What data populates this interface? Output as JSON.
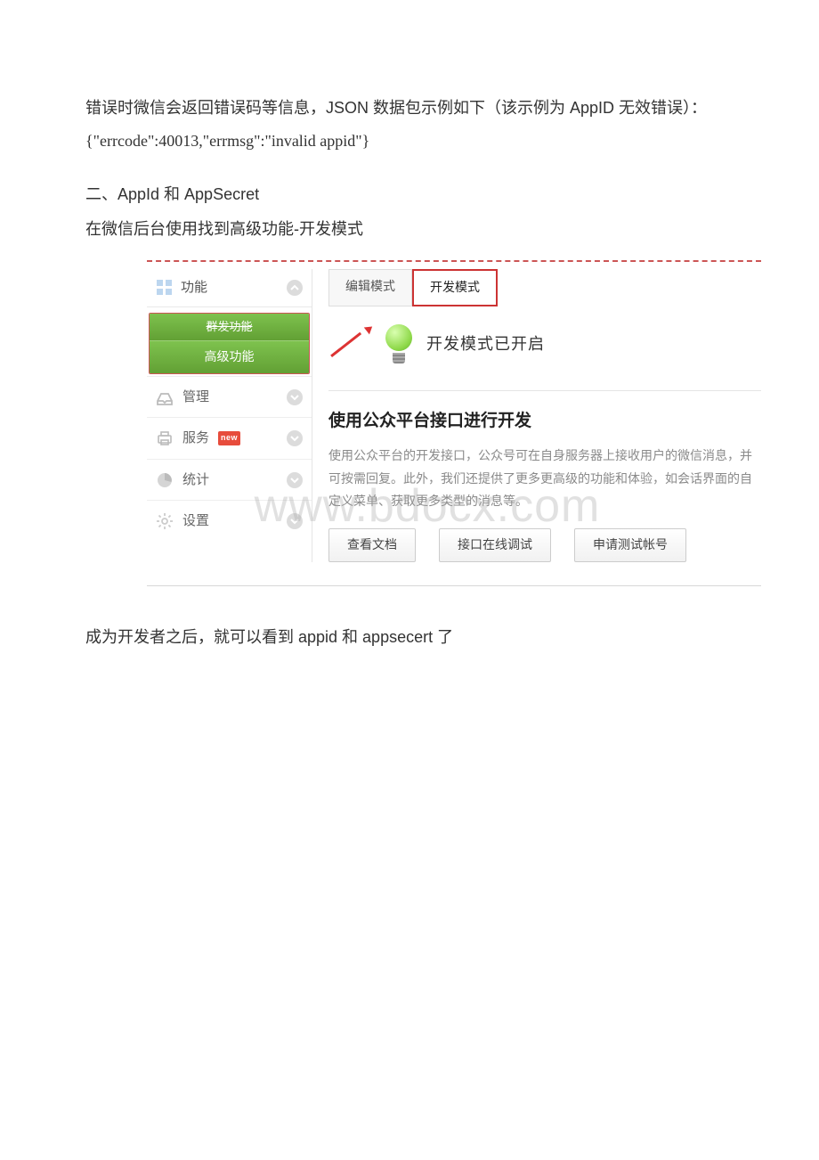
{
  "intro": {
    "p1": "错误时微信会返回错误码等信息，JSON 数据包示例如下（该示例为 AppID 无效错误）：",
    "code": "{\"errcode\":40013,\"errmsg\":\"invalid appid\"}",
    "section_title": "二、AppId 和 AppSecret",
    "p2": "在微信后台使用找到高级功能-开发模式"
  },
  "sidebar": {
    "func_label": "功能",
    "sub_top": "群发功能",
    "sub_bot": "高级功能",
    "manage": "管理",
    "service": "服务",
    "service_badge": "new",
    "stats": "统计",
    "settings": "设置"
  },
  "tabs": {
    "edit": "编辑模式",
    "dev": "开发模式"
  },
  "status": "开发模式已开启",
  "dev": {
    "title": "使用公众平台接口进行开发",
    "desc": "使用公众平台的开发接口，公众号可在自身服务器上接收用户的微信消息，并可按需回复。此外，我们还提供了更多更高级的功能和体验，如会话界面的自定义菜单、获取更多类型的消息等。"
  },
  "buttons": {
    "doc": "查看文档",
    "debug": "接口在线调试",
    "test": "申请测试帐号"
  },
  "watermark": "www.bdocx.com",
  "post": "成为开发者之后，就可以看到 appid 和 appsecert 了"
}
